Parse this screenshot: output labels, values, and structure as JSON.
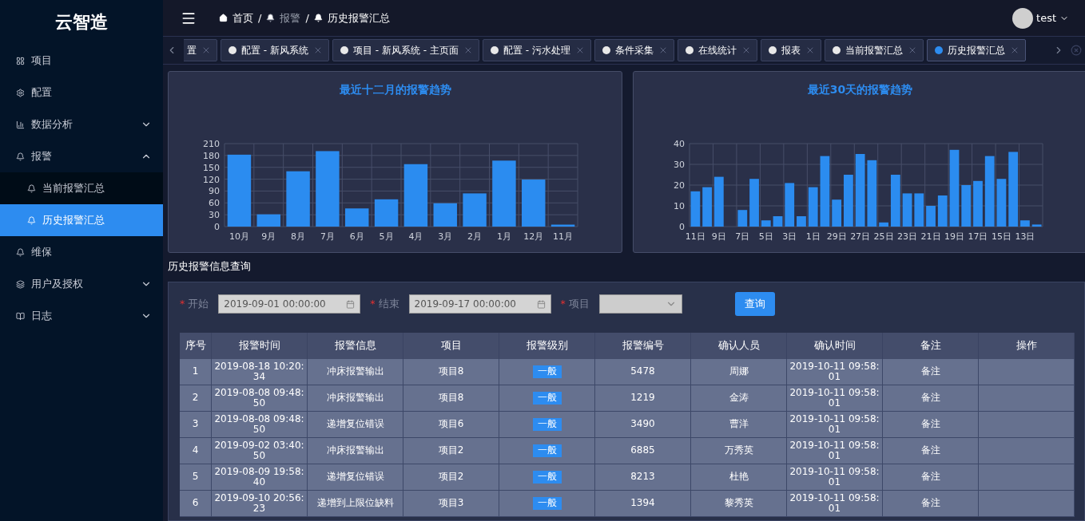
{
  "sidebar": {
    "logo": "云智造",
    "items": [
      {
        "label": "项目",
        "selected": false
      },
      {
        "label": "配置",
        "selected": false
      },
      {
        "label": "数据分析",
        "expanded": false,
        "selected": false
      },
      {
        "label": "报警",
        "expanded": true,
        "selected": false,
        "children": [
          {
            "label": "当前报警汇总",
            "selected": false
          },
          {
            "label": "历史报警汇总",
            "selected": true
          }
        ]
      },
      {
        "label": "维保",
        "selected": false
      },
      {
        "label": "用户及授权",
        "expanded": false,
        "selected": false
      },
      {
        "label": "日志",
        "expanded": false,
        "selected": false
      }
    ]
  },
  "header": {
    "breadcrumb": [
      {
        "label": "首页"
      },
      {
        "label": "报警"
      },
      {
        "label": "历史报警汇总"
      }
    ],
    "separator": "/",
    "user": "test"
  },
  "tabs": [
    {
      "label": "置",
      "selected": false
    },
    {
      "label": "配置 - 新风系统",
      "selected": false
    },
    {
      "label": "项目 - 新风系统 - 主页面",
      "selected": false
    },
    {
      "label": "配置 - 污水处理",
      "selected": false
    },
    {
      "label": "条件采集",
      "selected": false
    },
    {
      "label": "在线统计",
      "selected": false
    },
    {
      "label": "报表",
      "selected": false
    },
    {
      "label": "当前报警汇总",
      "selected": false
    },
    {
      "label": "历史报警汇总",
      "selected": true
    }
  ],
  "charts": [
    {
      "chart_data": {
        "type": "bar",
        "title": "最近十二月的报警趋势",
        "categories": [
          "10月",
          "9月",
          "8月",
          "7月",
          "6月",
          "5月",
          "4月",
          "3月",
          "2月",
          "1月",
          "12月",
          "11月"
        ],
        "series": [
          {
            "color": "#2b8cf0",
            "values": [
              182,
              31,
              140,
              191,
              46,
              69,
              158,
              59,
              84,
              167,
              119,
              5
            ]
          }
        ],
        "ylim": [
          0,
          210
        ],
        "yticks": [
          0,
          30,
          60,
          90,
          120,
          150,
          180,
          210
        ],
        "grid": true
      }
    },
    {
      "chart_data": {
        "type": "bar",
        "title": "最近30天的报警趋势",
        "categories": [
          "11日",
          null,
          "9日",
          null,
          "7日",
          null,
          "5日",
          null,
          "3日",
          null,
          "1日",
          null,
          "29日",
          null,
          "27日",
          null,
          "25日",
          null,
          "23日",
          null,
          "21日",
          null,
          "19日",
          null,
          "17日",
          null,
          "15日",
          null,
          "13日",
          null
        ],
        "series": [
          {
            "color": "#2b8cf0",
            "values": [
              17,
              19,
              24,
              0,
              8,
              23,
              3,
              5,
              21,
              5,
              19,
              34,
              13,
              25,
              35,
              32,
              2,
              25,
              16,
              16,
              10,
              15,
              37,
              20,
              22,
              34,
              23,
              36,
              3,
              1
            ]
          }
        ],
        "ylim": [
          0,
          40
        ],
        "yticks": [
          0,
          10,
          20,
          30,
          40
        ],
        "grid": true
      }
    }
  ],
  "query": {
    "title": "历史报警信息查询",
    "required_mark": "*",
    "fields": [
      {
        "label": "开始",
        "kind": "date",
        "value": "2019-09-01 00:00:00"
      },
      {
        "label": "结束",
        "kind": "date",
        "value": "2019-09-17 00:00:00"
      },
      {
        "label": "项目",
        "kind": "select",
        "disabled": true
      }
    ],
    "button": "查询"
  },
  "table": {
    "columns": [
      "序号",
      "报警时间",
      "报警信息",
      "项目",
      "报警级别",
      "报警编号",
      "确认人员",
      "确认时间",
      "备注",
      "操作"
    ],
    "rows": [
      [
        "1",
        "2019-08-18 10:20:34",
        "冲床报警输出",
        "项目8",
        "一般",
        "5478",
        "周娜",
        "2019-10-11 09:58:01",
        "备注"
      ],
      [
        "2",
        "2019-08-08 09:48:50",
        "冲床报警输出",
        "项目8",
        "一般",
        "1219",
        "金涛",
        "2019-10-11 09:58:01",
        "备注"
      ],
      [
        "3",
        "2019-08-08 09:48:50",
        "递增复位错误",
        "项目6",
        "一般",
        "3490",
        "曹洋",
        "2019-10-11 09:58:01",
        "备注"
      ],
      [
        "4",
        "2019-09-02 03:40:50",
        "冲床报警输出",
        "项目2",
        "一般",
        "6885",
        "万秀英",
        "2019-10-11 09:58:01",
        "备注"
      ],
      [
        "5",
        "2019-08-09 19:58:40",
        "递增复位错误",
        "项目2",
        "一般",
        "8213",
        "杜艳",
        "2019-10-11 09:58:01",
        "备注"
      ],
      [
        "6",
        "2019-09-10 20:56:23",
        "递增到上限位缺料",
        "项目3",
        "一般",
        "1394",
        "黎秀英",
        "2019-10-11 09:58:01",
        "备注"
      ]
    ]
  }
}
